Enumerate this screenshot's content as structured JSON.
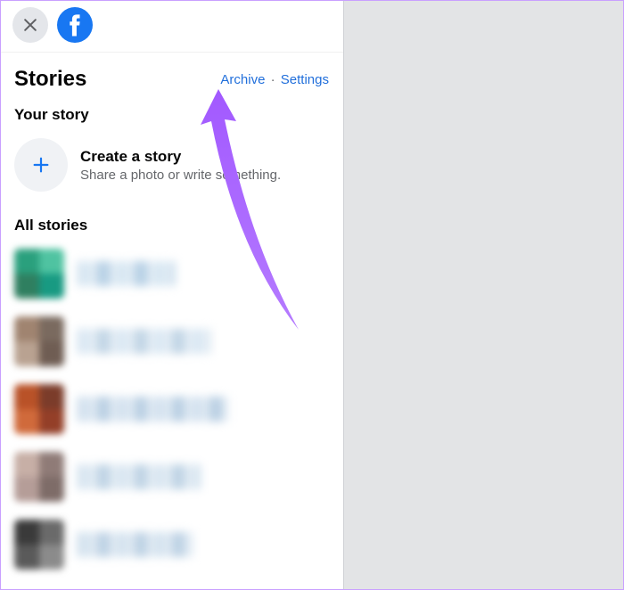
{
  "header": {
    "close_label": "Close"
  },
  "title": "Stories",
  "links": {
    "archive": "Archive",
    "settings": "Settings",
    "separator": "·"
  },
  "your_story": {
    "heading": "Your story",
    "create_title": "Create a story",
    "create_subtitle": "Share a photo or write something."
  },
  "all_stories": {
    "heading": "All stories"
  },
  "colors": {
    "accent": "#1877f2",
    "text_primary": "#050505",
    "text_secondary": "#65676b",
    "highlight": "#a259ff"
  }
}
